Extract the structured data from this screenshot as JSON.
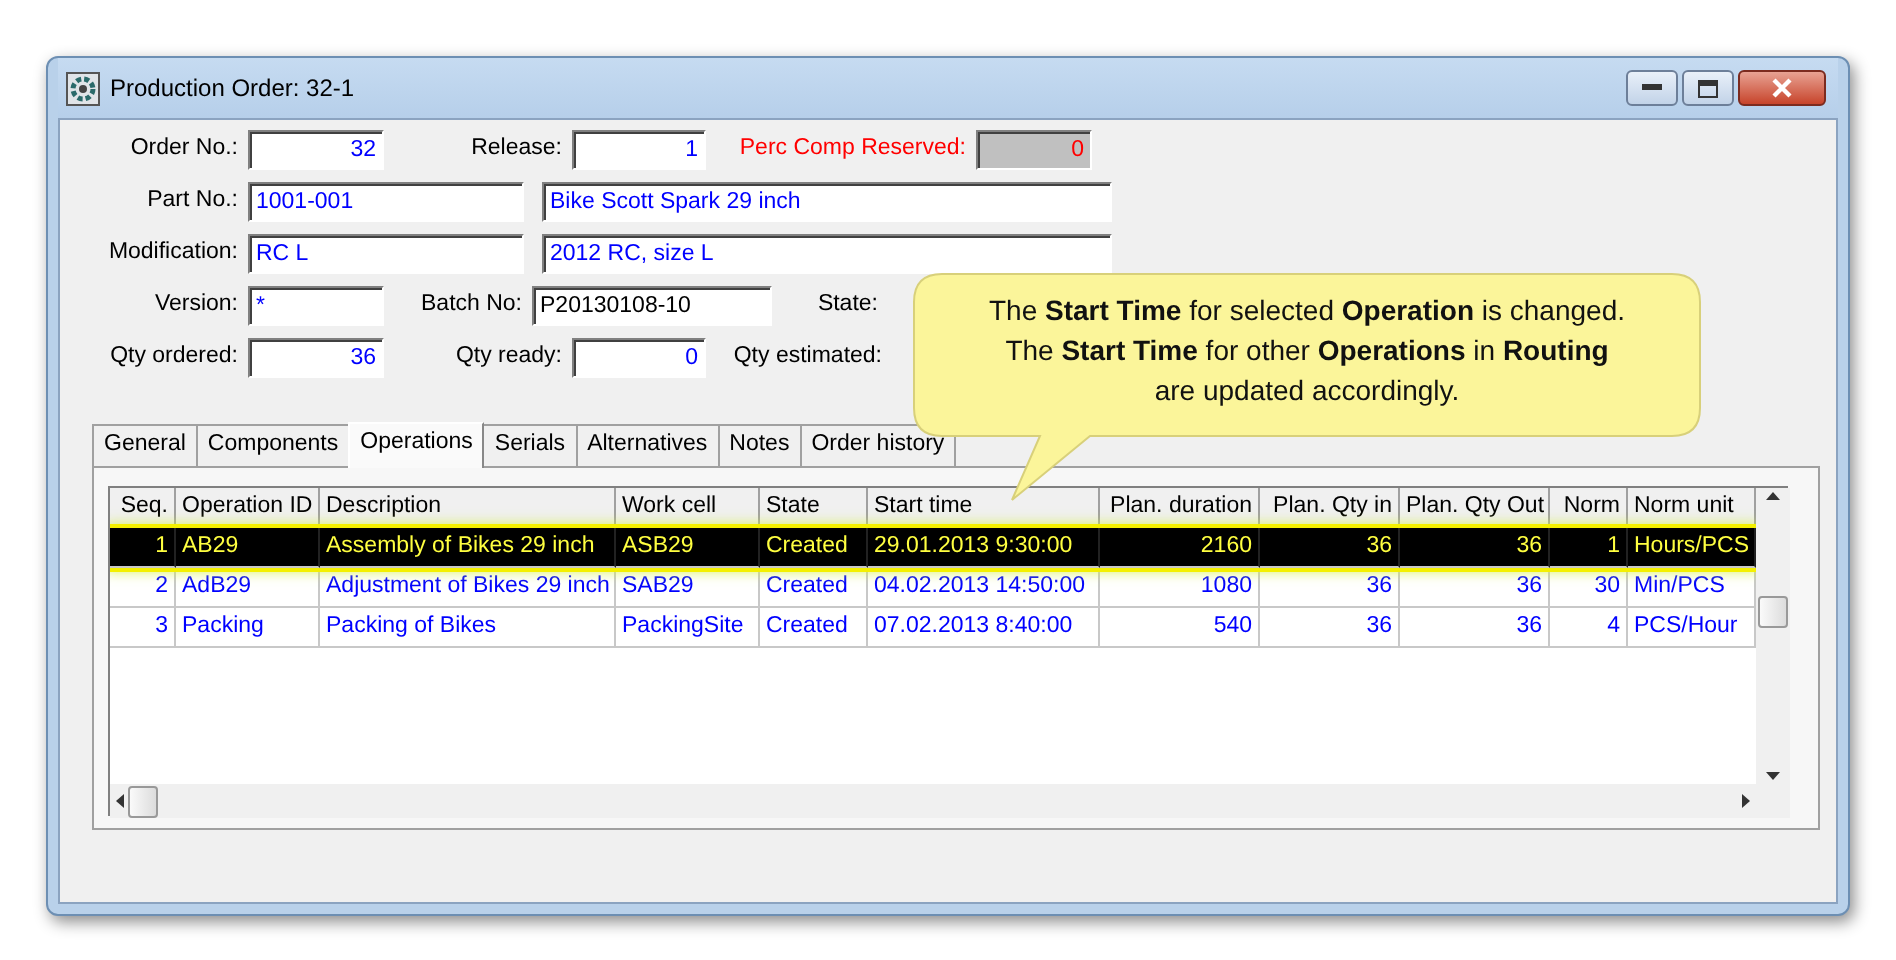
{
  "window": {
    "title": "Production Order: 32-1"
  },
  "form": {
    "rows": [
      [
        {
          "label": "Order No.:",
          "value": "32",
          "kind": "number"
        },
        {
          "label": "Release:",
          "value": "1",
          "kind": "number"
        },
        {
          "label": "Perc Comp Reserved:",
          "value": "0",
          "kind": "reserved"
        }
      ],
      [
        {
          "label": "Part No.:",
          "value": "1001-001",
          "kind": "text"
        },
        {
          "value": "Bike Scott Spark 29 inch",
          "kind": "text"
        }
      ],
      [
        {
          "label": "Modification:",
          "value": "RC L",
          "kind": "text"
        },
        {
          "value": "2012 RC, size L",
          "kind": "text"
        }
      ],
      [
        {
          "label": "Version:",
          "value": "*",
          "kind": "text"
        },
        {
          "label": "Batch No:",
          "value": "P20130108-10",
          "kind": "plain"
        },
        {
          "label": "State:",
          "kind": "covered"
        }
      ],
      [
        {
          "label": "Qty ordered:",
          "value": "36",
          "kind": "number"
        },
        {
          "label": "Qty ready:",
          "value": "0",
          "kind": "number"
        },
        {
          "label": "Qty estimated:",
          "kind": "covered"
        }
      ]
    ]
  },
  "tabs": [
    {
      "label": "General",
      "selected": false
    },
    {
      "label": "Components",
      "selected": false
    },
    {
      "label": "Operations",
      "selected": true
    },
    {
      "label": "Serials",
      "selected": false
    },
    {
      "label": "Alternatives",
      "selected": false
    },
    {
      "label": "Notes",
      "selected": false
    },
    {
      "label": "Order history",
      "selected": false
    }
  ],
  "table": {
    "columns": [
      {
        "label": "Seq."
      },
      {
        "label": "Operation ID"
      },
      {
        "label": "Description"
      },
      {
        "label": "Work cell"
      },
      {
        "label": "State"
      },
      {
        "label": "Start time"
      },
      {
        "label": "Plan. duration"
      },
      {
        "label": "Plan. Qty in"
      },
      {
        "label": "Plan. Qty Out"
      },
      {
        "label": "Norm"
      },
      {
        "label": "Norm unit"
      }
    ],
    "rows": [
      {
        "selected": true,
        "cells": [
          "1",
          "AB29",
          "Assembly of Bikes 29 inch",
          "ASB29",
          "Created",
          "29.01.2013 9:30:00",
          "2160",
          "36",
          "36",
          "1",
          "Hours/PCS"
        ]
      },
      {
        "selected": false,
        "cells": [
          "2",
          "AdB29",
          "Adjustment of Bikes 29 inch",
          "SAB29",
          "Created",
          "04.02.2013 14:50:00",
          "1080",
          "36",
          "36",
          "30",
          "Min/PCS"
        ]
      },
      {
        "selected": false,
        "cells": [
          "3",
          "Packing",
          "Packing of Bikes",
          "PackingSite",
          "Created",
          "07.02.2013 8:40:00",
          "540",
          "36",
          "36",
          "4",
          "PCS/Hour"
        ]
      }
    ]
  },
  "callout": {
    "lines": [
      "The **Start Time** for selected **Operation** is changed.",
      "The **Start Time** for other **Operations** in **Routing**",
      "are updated accordingly."
    ]
  }
}
